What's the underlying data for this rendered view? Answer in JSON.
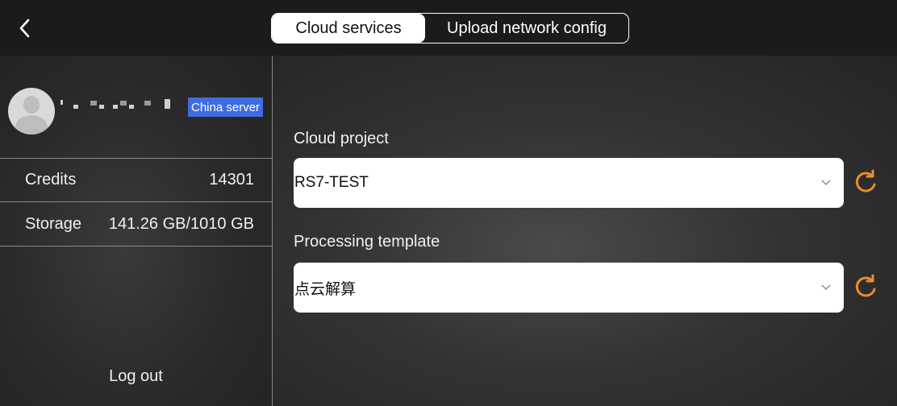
{
  "header": {
    "back_icon": "chevron-left-icon",
    "tabs": [
      {
        "label": "Cloud services",
        "active": true
      },
      {
        "label": "Upload network config",
        "active": false
      }
    ]
  },
  "sidebar": {
    "profile": {
      "avatar_icon": "avatar-placeholder-icon",
      "server_badge": "China server",
      "badge_color": "#3f6de0"
    },
    "credits": {
      "label": "Credits",
      "value": "14301"
    },
    "storage": {
      "label": "Storage",
      "value": "141.26 GB/1010 GB"
    },
    "logout_label": "Log out"
  },
  "main": {
    "cloud_project": {
      "label": "Cloud project",
      "value": "RS7-TEST"
    },
    "processing_template": {
      "label": "Processing template",
      "value": "点云解算"
    },
    "refresh_icon": "refresh-icon",
    "accent_color": "#f08a2c"
  }
}
